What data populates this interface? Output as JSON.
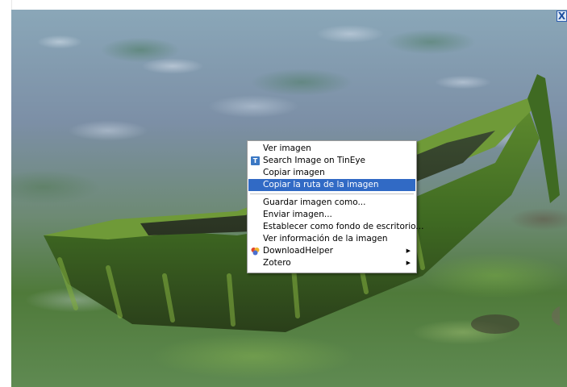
{
  "close_button": {
    "label": "X"
  },
  "context_menu": {
    "items": [
      {
        "label": "Ver imagen"
      },
      {
        "label": "Search Image on TinEye",
        "icon": "tineye-icon",
        "icon_letter": "T"
      },
      {
        "label": "Copiar imagen"
      },
      {
        "label": "Copiar la ruta de la imagen",
        "highlighted": true
      },
      {
        "label": "Guardar imagen como..."
      },
      {
        "label": "Enviar imagen..."
      },
      {
        "label": "Establecer como fondo de escritorio..."
      },
      {
        "label": "Ver información de la imagen"
      },
      {
        "label": "DownloadHelper",
        "icon": "downloadhelper-icon",
        "submenu": true
      },
      {
        "label": "Zotero",
        "submenu": true
      }
    ],
    "submenu_arrow": "▶"
  },
  "colors": {
    "highlight": "#316ac5",
    "close_border": "#2f5fb0"
  }
}
